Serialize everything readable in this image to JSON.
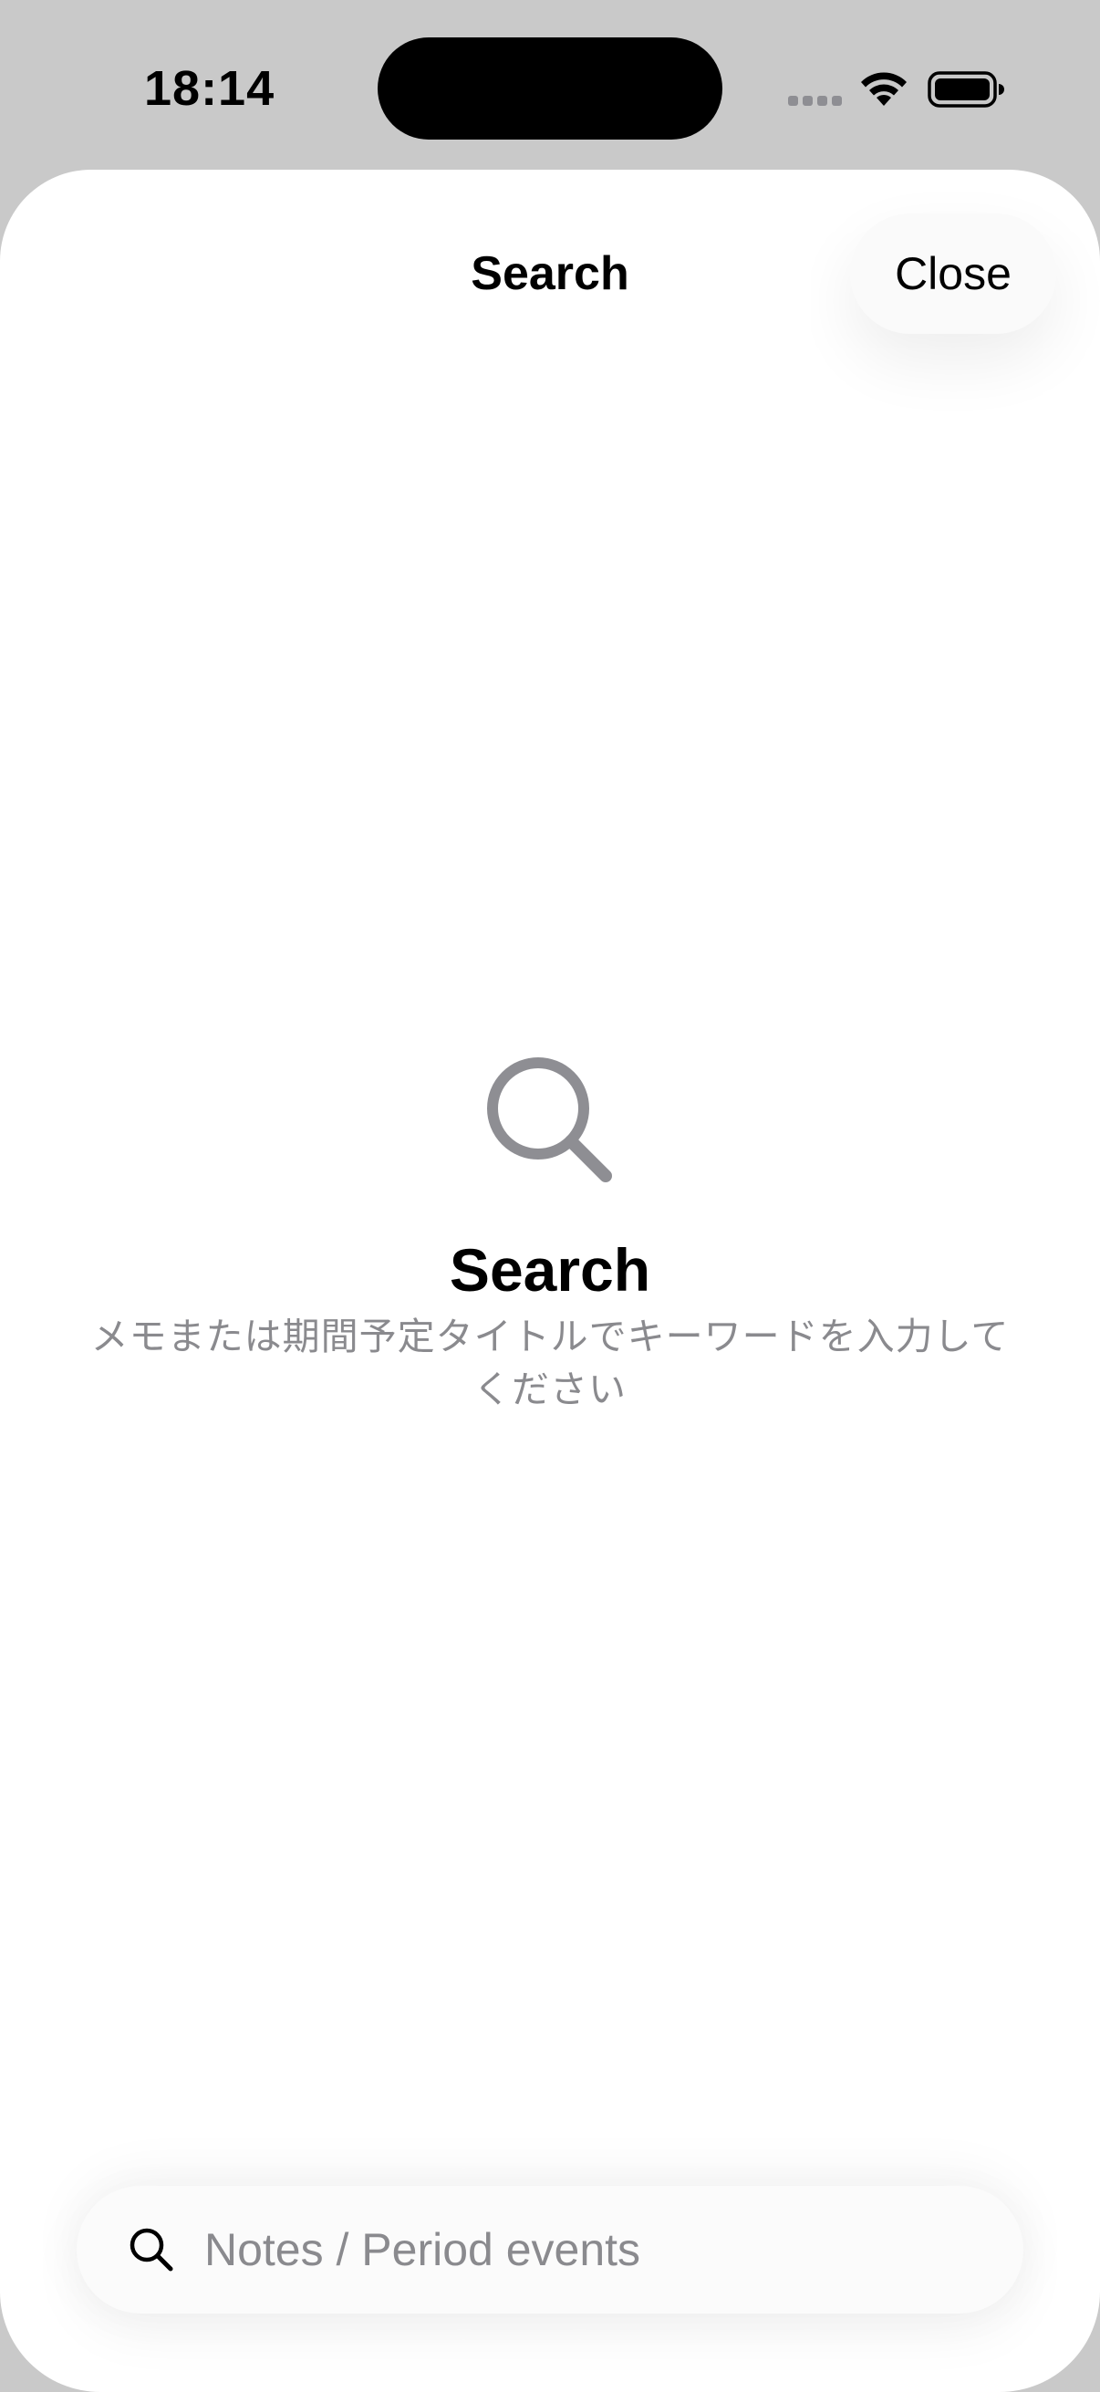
{
  "status_bar": {
    "time": "18:14"
  },
  "sheet": {
    "title": "Search",
    "close_label": "Close"
  },
  "empty_state": {
    "icon": "magnifying-glass",
    "title": "Search",
    "message": "メモまたは期間予定タイトルでキーワードを入力してください"
  },
  "search": {
    "icon": "magnifying-glass",
    "value": "",
    "placeholder": "Notes / Period events"
  },
  "colors": {
    "background_dim": "#c9c9c9",
    "sheet": "#ffffff",
    "secondary_text": "#8a8a8e",
    "icon_gray": "#8e8e93"
  }
}
